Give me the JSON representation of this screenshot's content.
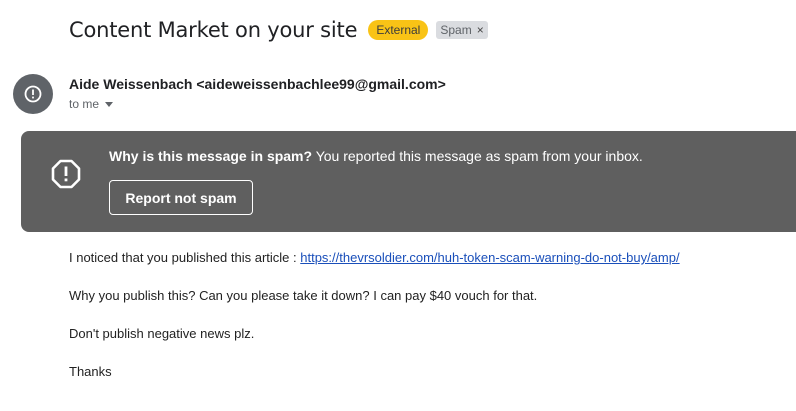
{
  "message": {
    "subject": "Content Market on your site",
    "labels": {
      "external": "External",
      "spam": "Spam",
      "remove_symbol": "×"
    },
    "sender": "Aide Weissenbach <aideweissenbachlee99@gmail.com>",
    "recipient": "to me"
  },
  "spam_banner": {
    "question": "Why is this message in spam?",
    "reason": " You reported this message as spam from your inbox.",
    "button_label": "Report not spam"
  },
  "body": {
    "line1_prefix": "I noticed that you published this article : ",
    "line1_link": "https://thevrsoldier.com/huh-token-scam-warning-do-not-buy/amp/",
    "line2": "Why you publish this? Can you please take it down? I can pay $40 vouch for that.",
    "line3": "Don't publish negative news plz.",
    "line4": "Thanks"
  },
  "colors": {
    "external_badge": "#f9c316",
    "spam_badge": "#dadce0",
    "banner_bg": "#5f5f5f",
    "avatar_bg": "#5f6368",
    "link": "#1a4fba"
  },
  "icons": {
    "avatar": "alert-circle-icon",
    "banner": "alert-octagon-icon",
    "recipient_caret": "caret-down-icon",
    "remove_label": "close-icon"
  }
}
